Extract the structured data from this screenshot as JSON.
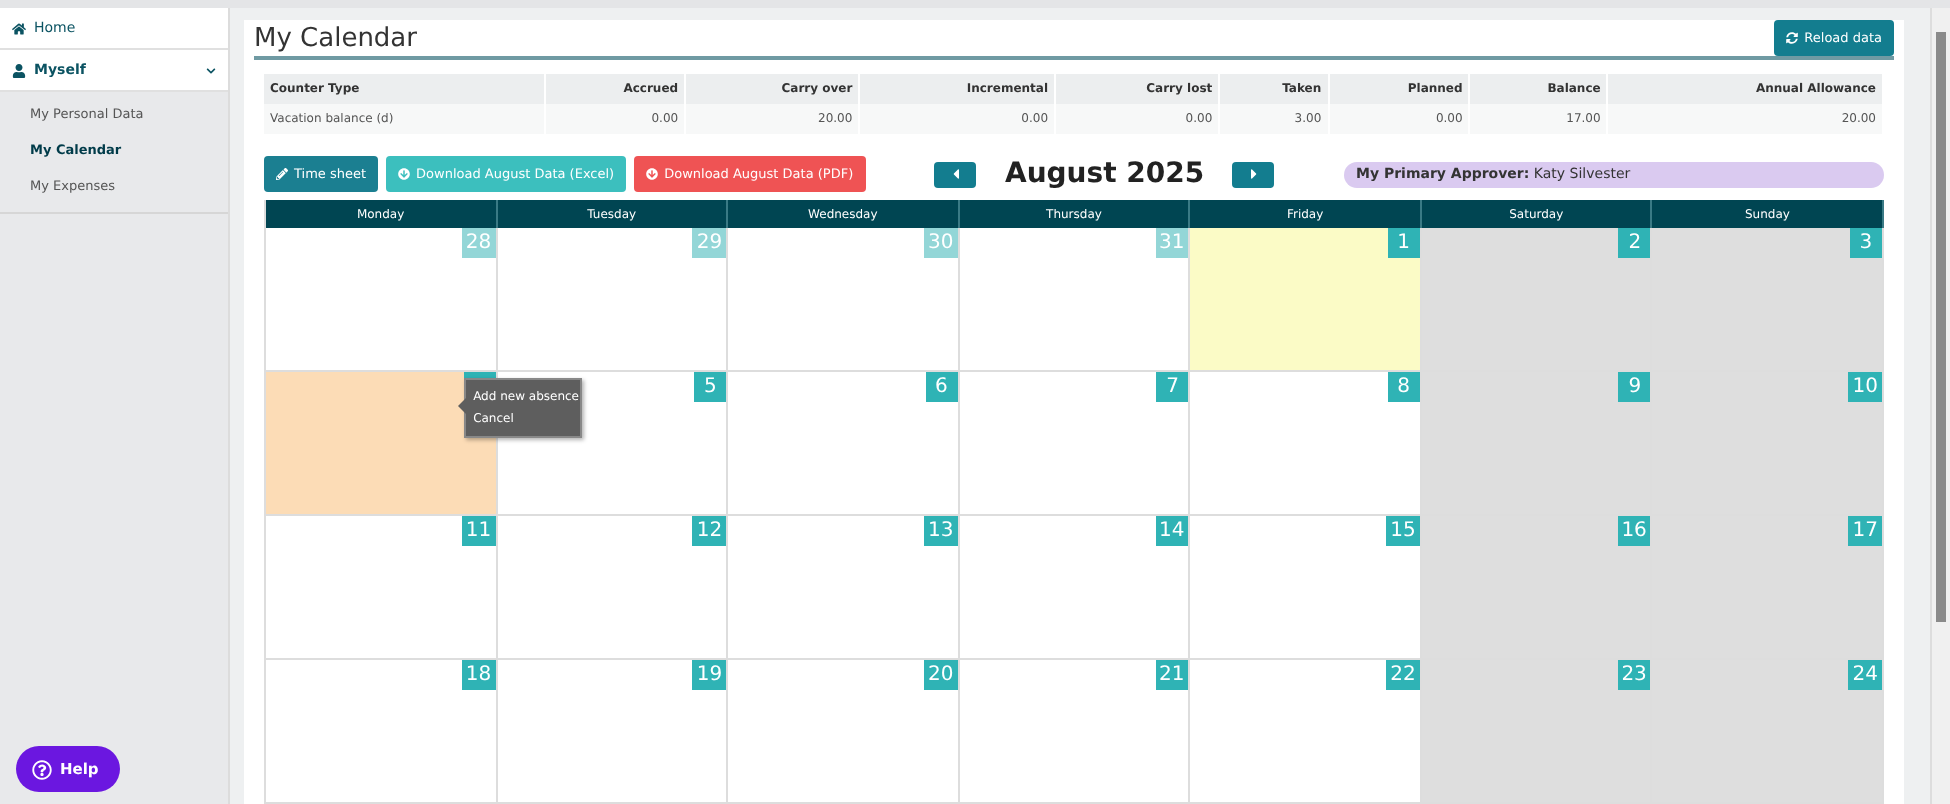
{
  "sidebar": {
    "items": [
      {
        "label": "Home",
        "kind": "home",
        "selected": false
      },
      {
        "label": "Myself",
        "kind": "user",
        "expanded": true,
        "children": [
          {
            "label": "My Personal Data",
            "selected": false
          },
          {
            "label": "My Calendar",
            "selected": true
          },
          {
            "label": "My Expenses",
            "selected": false
          }
        ]
      }
    ]
  },
  "page": {
    "title": "My Calendar",
    "reload_button": "Reload data"
  },
  "balance_table": {
    "columns": [
      "Counter Type",
      "Accrued",
      "Carry over",
      "Incremental",
      "Carry lost",
      "Taken",
      "Planned",
      "Balance",
      "Annual Allowance"
    ],
    "rows": [
      [
        "Vacation balance (d)",
        "0.00",
        "20.00",
        "0.00",
        "0.00",
        "3.00",
        "0.00",
        "17.00",
        "20.00"
      ]
    ]
  },
  "actions": [
    {
      "label": "Time sheet",
      "kind": "timesheet"
    },
    {
      "label": "Download August Data (Excel)",
      "kind": "excel"
    },
    {
      "label": "Download August Data (PDF)",
      "kind": "pdf"
    }
  ],
  "month": "August 2025",
  "approver": {
    "label": "My Primary Approver:",
    "name": "Katy Silvester"
  },
  "calendar": {
    "days_of_week": [
      {
        "label": "Monday",
        "weekend": false
      },
      {
        "label": "Tuesday",
        "weekend": false
      },
      {
        "label": "Wednesday",
        "weekend": false
      },
      {
        "label": "Thursday",
        "weekend": false
      },
      {
        "label": "Friday",
        "weekend": false
      },
      {
        "label": "Saturday",
        "weekend": true
      },
      {
        "label": "Sunday",
        "weekend": true
      }
    ],
    "weeks": [
      [
        {
          "day": "28",
          "outside_month": true,
          "today": false,
          "selected": false
        },
        {
          "day": "29",
          "outside_month": true,
          "today": false,
          "selected": false
        },
        {
          "day": "30",
          "outside_month": true,
          "today": false,
          "selected": false
        },
        {
          "day": "31",
          "outside_month": true,
          "today": false,
          "selected": false
        },
        {
          "day": "1",
          "outside_month": false,
          "today": true,
          "selected": false
        },
        {
          "day": "2",
          "outside_month": false,
          "today": false,
          "selected": false
        },
        {
          "day": "3",
          "outside_month": false,
          "today": false,
          "selected": false
        }
      ],
      [
        {
          "outside_month": false,
          "today": false,
          "selected": true,
          "menu": [
            "Add new absence",
            "Cancel"
          ]
        },
        {
          "day": "5",
          "outside_month": false,
          "today": false,
          "selected": false
        },
        {
          "day": "6",
          "outside_month": false,
          "today": false,
          "selected": false
        },
        {
          "day": "7",
          "outside_month": false,
          "today": false,
          "selected": false
        },
        {
          "day": "8",
          "outside_month": false,
          "today": false,
          "selected": false
        },
        {
          "day": "9",
          "outside_month": false,
          "today": false,
          "selected": false
        },
        {
          "day": "10",
          "outside_month": false,
          "today": false,
          "selected": false
        }
      ],
      [
        {
          "day": "11",
          "outside_month": false,
          "today": false,
          "selected": false
        },
        {
          "day": "12",
          "outside_month": false,
          "today": false,
          "selected": false
        },
        {
          "day": "13",
          "outside_month": false,
          "today": false,
          "selected": false
        },
        {
          "day": "14",
          "outside_month": false,
          "today": false,
          "selected": false
        },
        {
          "day": "15",
          "outside_month": false,
          "today": false,
          "selected": false
        },
        {
          "day": "16",
          "outside_month": false,
          "today": false,
          "selected": false
        },
        {
          "day": "17",
          "outside_month": false,
          "today": false,
          "selected": false
        }
      ],
      [
        {
          "day": "18",
          "outside_month": false,
          "today": false,
          "selected": false
        },
        {
          "day": "19",
          "outside_month": false,
          "today": false,
          "selected": false
        },
        {
          "day": "20",
          "outside_month": false,
          "today": false,
          "selected": false
        },
        {
          "day": "21",
          "outside_month": false,
          "today": false,
          "selected": false
        },
        {
          "day": "22",
          "outside_month": false,
          "today": false,
          "selected": false
        },
        {
          "day": "23",
          "outside_month": false,
          "today": false,
          "selected": false
        },
        {
          "day": "24",
          "outside_month": false,
          "today": false,
          "selected": false
        }
      ]
    ]
  },
  "help_button": "Help"
}
